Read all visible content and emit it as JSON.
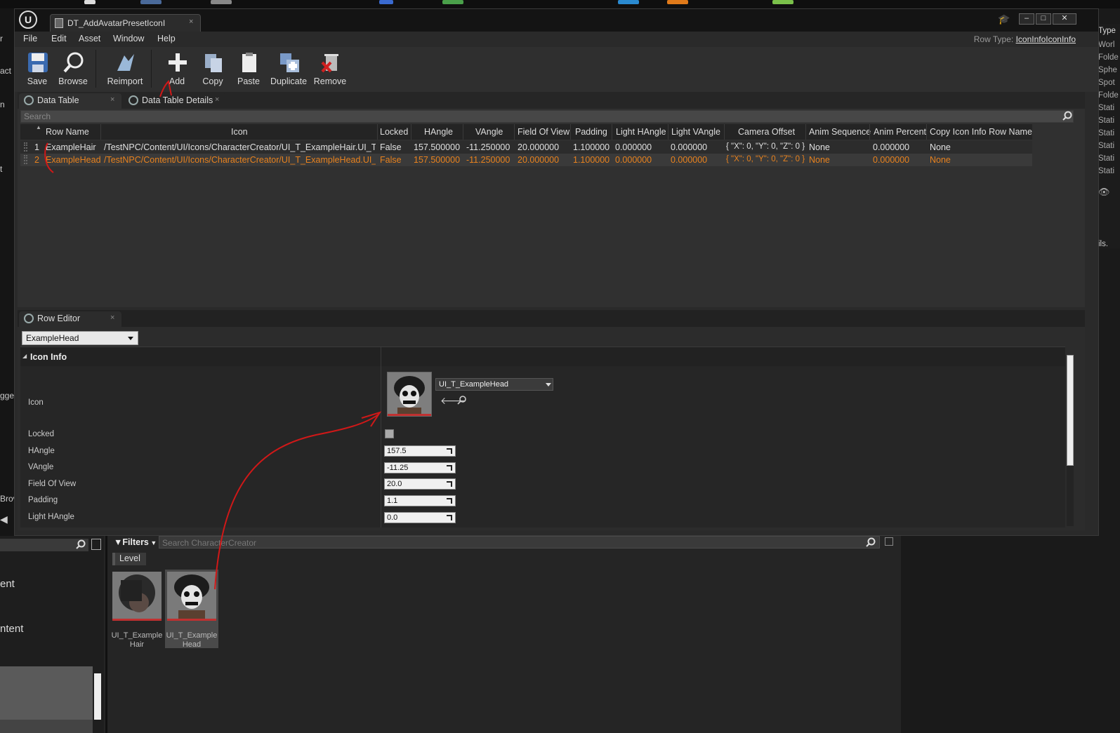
{
  "window": {
    "tab_title": "DT_AddAvatarPresetIconI",
    "tab_close": "×",
    "logo": "U",
    "controls": [
      "–",
      "□",
      "✕"
    ]
  },
  "menu": [
    "File",
    "Edit",
    "Asset",
    "Window",
    "Help"
  ],
  "row_type": {
    "label": "Row Type:",
    "value": "IconInfoIconInfo"
  },
  "toolbar": [
    {
      "label": "Save",
      "icon": "save-icon"
    },
    {
      "label": "Browse",
      "icon": "browse-icon"
    },
    {
      "label": "Reimport",
      "icon": "reimport-icon"
    },
    {
      "label": "Add",
      "icon": "add-icon"
    },
    {
      "label": "Copy",
      "icon": "copy-icon"
    },
    {
      "label": "Paste",
      "icon": "paste-icon"
    },
    {
      "label": "Duplicate",
      "icon": "duplicate-icon"
    },
    {
      "label": "Remove",
      "icon": "remove-icon"
    }
  ],
  "tabs": [
    {
      "label": "Data Table"
    },
    {
      "label": "Data Table Details"
    }
  ],
  "search_placeholder": "Search",
  "table": {
    "columns": [
      "Row Name",
      "Icon",
      "Locked",
      "HAngle",
      "VAngle",
      "Field Of View",
      "Padding",
      "Light HAngle",
      "Light VAngle",
      "Camera Offset",
      "Anim Sequence",
      "Anim Percent",
      "Copy Icon Info Row Name"
    ],
    "rows": [
      [
        "1",
        "ExampleHair",
        "/TestNPC/Content/UI/Icons/CharacterCreator/UI_T_ExampleHair.UI_T_Ex",
        "False",
        "157.500000",
        "-11.250000",
        "20.000000",
        "1.100000",
        "0.000000",
        "0.000000",
        "{ \"X\": 0, \"Y\": 0, \"Z\": 0 }",
        "None",
        "0.000000",
        "None"
      ],
      [
        "2",
        "ExampleHead",
        "/TestNPC/Content/UI/Icons/CharacterCreator/UI_T_ExampleHead.UI_T_E",
        "False",
        "157.500000",
        "-11.250000",
        "20.000000",
        "1.100000",
        "0.000000",
        "0.000000",
        "{ \"X\": 0, \"Y\": 0, \"Z\": 0 }",
        "None",
        "0.000000",
        "None"
      ]
    ],
    "selected_row": 2,
    "highlight_color": "#e8821e"
  },
  "row_editor": {
    "tab_label": "Row Editor",
    "selected_row": "ExampleHead",
    "category": "Icon Info",
    "props": [
      {
        "label": "Icon"
      },
      {
        "label": "Locked"
      },
      {
        "label": "HAngle",
        "value": "157.5"
      },
      {
        "label": "VAngle",
        "value": "-11.25"
      },
      {
        "label": "Field Of View",
        "value": "20.0"
      },
      {
        "label": "Padding",
        "value": "1.1"
      },
      {
        "label": "Light HAngle",
        "value": "0.0"
      }
    ],
    "icon_asset": "UI_T_ExampleHead"
  },
  "content_browser": {
    "filters_label": "Filters",
    "search_placeholder": "Search CharacterCreator",
    "level_chip": "Level",
    "left_items": [
      "ent",
      "ntent"
    ],
    "assets": [
      {
        "name_line1": "UI_T_Example",
        "name_line2": "Hair"
      },
      {
        "name_line1": "UI_T_Example",
        "name_line2": "Head"
      }
    ]
  },
  "bg_left": [
    "r",
    "act",
    "n",
    "t",
    "gger",
    "Brov"
  ],
  "bg_right": [
    "Type",
    "Worl",
    "Folde",
    "Sphe",
    "Spot",
    "Folde",
    "Stati",
    "Stati",
    "Stati",
    "Stati",
    "Stati",
    "Stati"
  ],
  "bg_right_misc": "ils.",
  "annotation_color": "#d01818"
}
